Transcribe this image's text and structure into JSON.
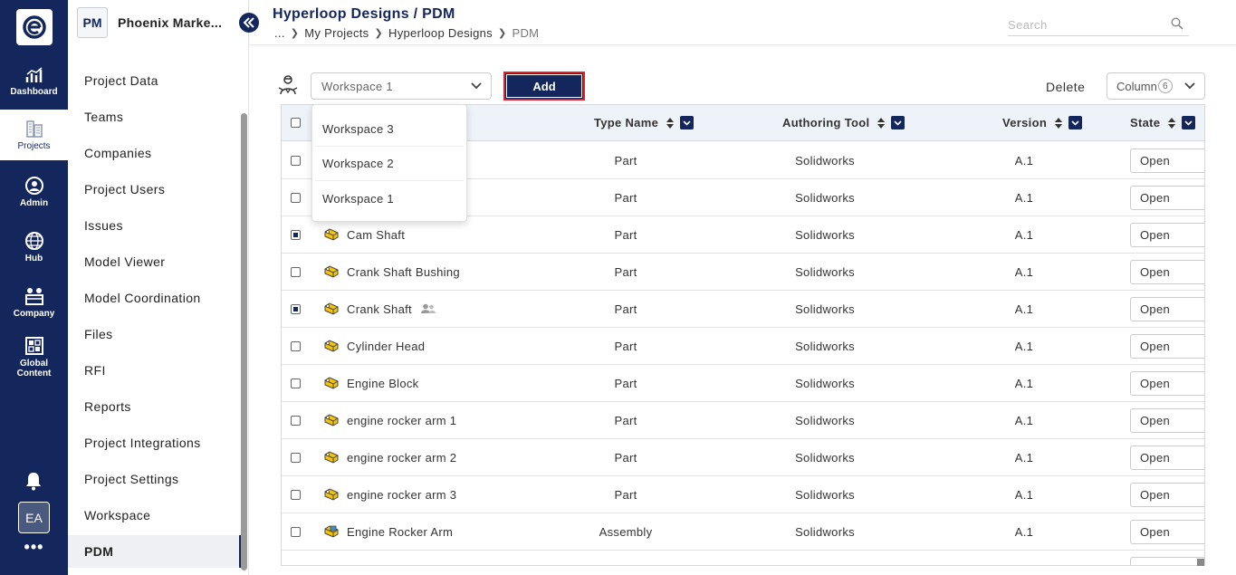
{
  "rail": {
    "items": [
      {
        "label": "Dashboard",
        "icon": "chart-icon"
      },
      {
        "label": "Projects",
        "icon": "buildings-icon"
      },
      {
        "label": "Admin",
        "icon": "admin-icon"
      },
      {
        "label": "Hub",
        "icon": "globe-icon"
      },
      {
        "label": "Company",
        "icon": "company-icon"
      },
      {
        "label": "Global Content",
        "icon": "grid-icon"
      }
    ],
    "user_initials": "EA",
    "more": "•••"
  },
  "project": {
    "badge": "PM",
    "title": "Phoenix Marke...",
    "nav": [
      "Project Data",
      "Teams",
      "Companies",
      "Project Users",
      "Issues",
      "Model Viewer",
      "Model Coordination",
      "Files",
      "RFI",
      "Reports",
      "Project Integrations",
      "Project Settings",
      "Workspace",
      "PDM"
    ],
    "active": "PDM"
  },
  "header": {
    "title": "Hyperloop Designs / PDM",
    "crumbs": [
      "...",
      "My Projects",
      "Hyperloop Designs",
      "PDM"
    ],
    "search_placeholder": "Search"
  },
  "toolbar": {
    "workspace_selected": "Workspace 1",
    "add_label": "Add",
    "delete_label": "Delete",
    "columns_label": "Column",
    "columns_count": "6"
  },
  "workspace_options": [
    "Workspace 3",
    "Workspace 2",
    "Workspace 1"
  ],
  "table": {
    "headers": {
      "type": "Type Name",
      "tool": "Authoring Tool",
      "version": "Version",
      "state": "State"
    },
    "rows": [
      {
        "name": "",
        "type": "Part",
        "tool": "Solidworks",
        "version": "A.1",
        "state": "Open",
        "checked": false,
        "shared": false,
        "kind": "part"
      },
      {
        "name": "",
        "type": "Part",
        "tool": "Solidworks",
        "version": "A.1",
        "state": "Open",
        "checked": false,
        "shared": false,
        "kind": "part"
      },
      {
        "name": "Cam Shaft",
        "type": "Part",
        "tool": "Solidworks",
        "version": "A.1",
        "state": "Open",
        "checked": true,
        "shared": false,
        "kind": "part"
      },
      {
        "name": "Crank Shaft Bushing",
        "type": "Part",
        "tool": "Solidworks",
        "version": "A.1",
        "state": "Open",
        "checked": false,
        "shared": false,
        "kind": "part"
      },
      {
        "name": "Crank Shaft",
        "type": "Part",
        "tool": "Solidworks",
        "version": "A.1",
        "state": "Open",
        "checked": true,
        "shared": true,
        "kind": "part"
      },
      {
        "name": "Cylinder Head",
        "type": "Part",
        "tool": "Solidworks",
        "version": "A.1",
        "state": "Open",
        "checked": false,
        "shared": false,
        "kind": "part"
      },
      {
        "name": "Engine Block",
        "type": "Part",
        "tool": "Solidworks",
        "version": "A.1",
        "state": "Open",
        "checked": false,
        "shared": false,
        "kind": "part"
      },
      {
        "name": "engine rocker arm 1",
        "type": "Part",
        "tool": "Solidworks",
        "version": "A.1",
        "state": "Open",
        "checked": false,
        "shared": false,
        "kind": "part"
      },
      {
        "name": "engine rocker arm 2",
        "type": "Part",
        "tool": "Solidworks",
        "version": "A.1",
        "state": "Open",
        "checked": false,
        "shared": false,
        "kind": "part"
      },
      {
        "name": "engine rocker arm 3",
        "type": "Part",
        "tool": "Solidworks",
        "version": "A.1",
        "state": "Open",
        "checked": false,
        "shared": false,
        "kind": "part"
      },
      {
        "name": "Engine Rocker Arm",
        "type": "Assembly",
        "tool": "Solidworks",
        "version": "A.1",
        "state": "Open",
        "checked": false,
        "shared": false,
        "kind": "assembly"
      }
    ]
  },
  "colors": {
    "navy": "#14275c",
    "highlight": "#e0222a",
    "part": "#f2c40f"
  }
}
